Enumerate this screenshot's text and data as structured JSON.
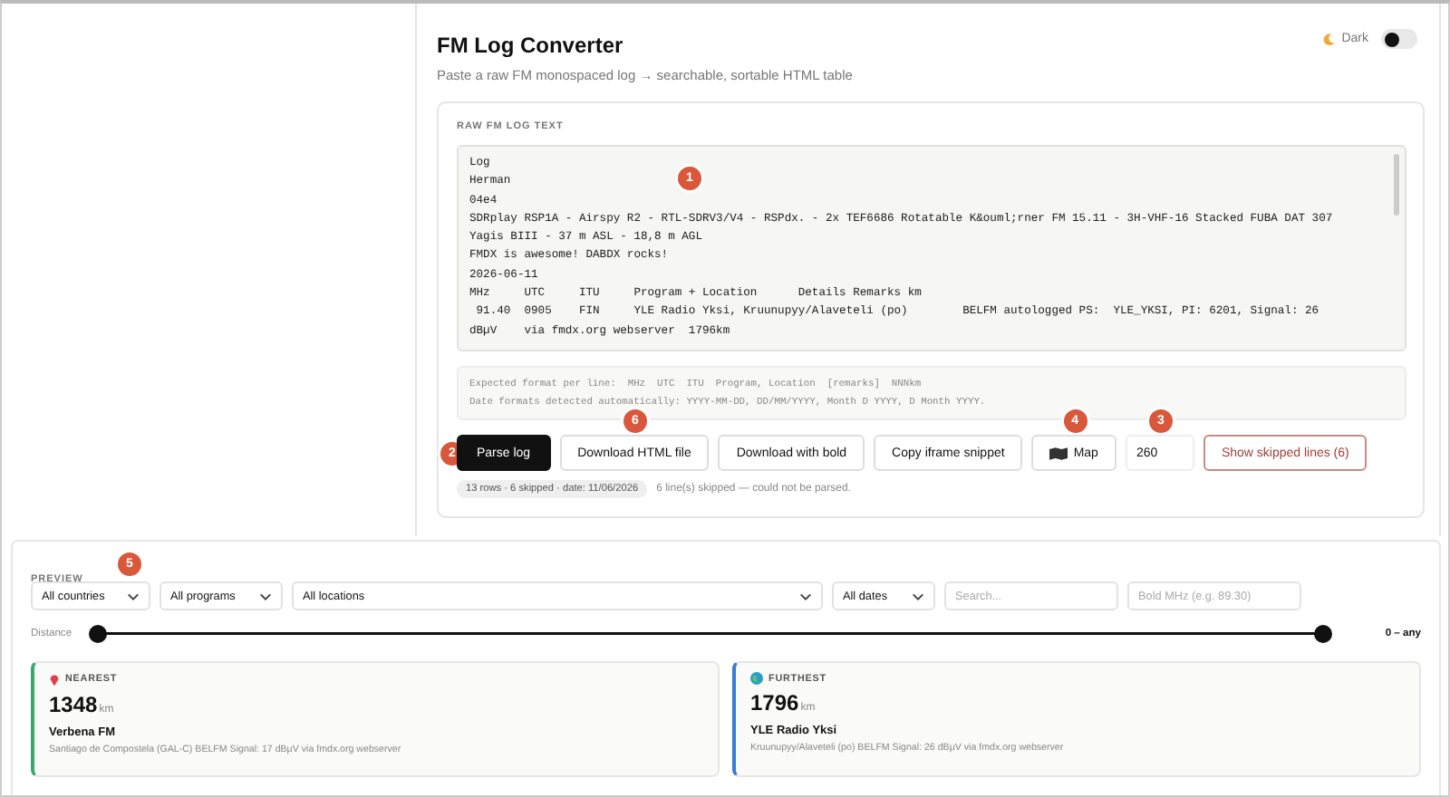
{
  "header": {
    "title": "FM Log Converter",
    "subtitle": "Paste a raw FM monospaced log → searchable, sortable HTML table",
    "dark_toggle": {
      "label": "Dark",
      "on": false
    }
  },
  "input": {
    "label": "RAW FM LOG TEXT",
    "badge": "1",
    "lines": [
      "Log",
      "Herman",
      "04e4",
      "SDRplay RSP1A - Airspy R2 - RTL-SDRV3/V4 - RSPdx. - 2x TEF6686 Rotatable K&ouml;rner FM 15.11 - 3H-VHF-16 Stacked FUBA DAT 307",
      "Yagis BIII - 37 m ASL - 18,8 m AGL",
      "FMDX is awesome! DABDX rocks!",
      "2026-06-11",
      "MHz     UTC     ITU     Program + Location      Details Remarks km",
      " 91.40  0905    FIN     YLE Radio Yksi, Kruunupyy/Alaveteli (po)        BELFM autologged PS:  YLE_YKSI, PI: 6201, Signal: 26",
      "dBµV    via fmdx.org webserver  1796km"
    ],
    "hints": [
      "Expected format per line:  MHz  UTC  ITU  Program, Location  [remarks]  NNNkm",
      "Date formats detected automatically: YYYY-MM-DD, DD/MM/YYYY, Month D YYYY, D Month YYYY."
    ]
  },
  "actions": [
    {
      "kind": "primary",
      "label": "Parse log",
      "badge": "2"
    },
    {
      "kind": "plain",
      "label": "Download HTML file",
      "badge": "6"
    },
    {
      "kind": "plain",
      "label": "Download with bold"
    },
    {
      "kind": "plain",
      "label": "Copy iframe snippet"
    },
    {
      "kind": "map",
      "label": "Map",
      "badge": "4"
    },
    {
      "kind": "field",
      "value": "260",
      "badge": "3"
    },
    {
      "kind": "danger",
      "label": "Show skipped lines (6)"
    }
  ],
  "status": {
    "chip": "13 rows · 6 skipped · date: 11/06/2026",
    "message": "6 line(s) skipped — could not be parsed."
  },
  "preview": {
    "label": "PREVIEW",
    "badge": "5",
    "filters": [
      {
        "kind": "select",
        "value": "All countries"
      },
      {
        "kind": "select",
        "value": "All programs"
      },
      {
        "kind": "wide-select",
        "value": "All locations"
      },
      {
        "kind": "select",
        "value": "All dates"
      },
      {
        "kind": "input",
        "placeholder": "Search..."
      },
      {
        "kind": "input",
        "placeholder": "Bold MHz (e.g. 89.30)"
      }
    ],
    "distance": {
      "label": "Distance",
      "thumbs": [
        {
          "level": 0
        },
        {
          "level": 1
        }
      ],
      "reading": "0 – any"
    },
    "cards": [
      {
        "kind": "nearest",
        "label": "NEAREST",
        "color": "#3aa76d",
        "value": "1348",
        "unit": "km",
        "name": "Verbena FM",
        "detail": "Santiago de Compostela (GAL-C) BELFM Signal: 17 dBµV via fmdx.org webserver"
      },
      {
        "kind": "furthest",
        "label": "FURTHEST",
        "color": "#3a7bd5",
        "value": "1796",
        "unit": "km",
        "name": "YLE Radio Yksi",
        "detail": "Kruunupyy/Alaveteli (po) BELFM Signal: 26 dBµV via fmdx.org webserver"
      }
    ]
  }
}
